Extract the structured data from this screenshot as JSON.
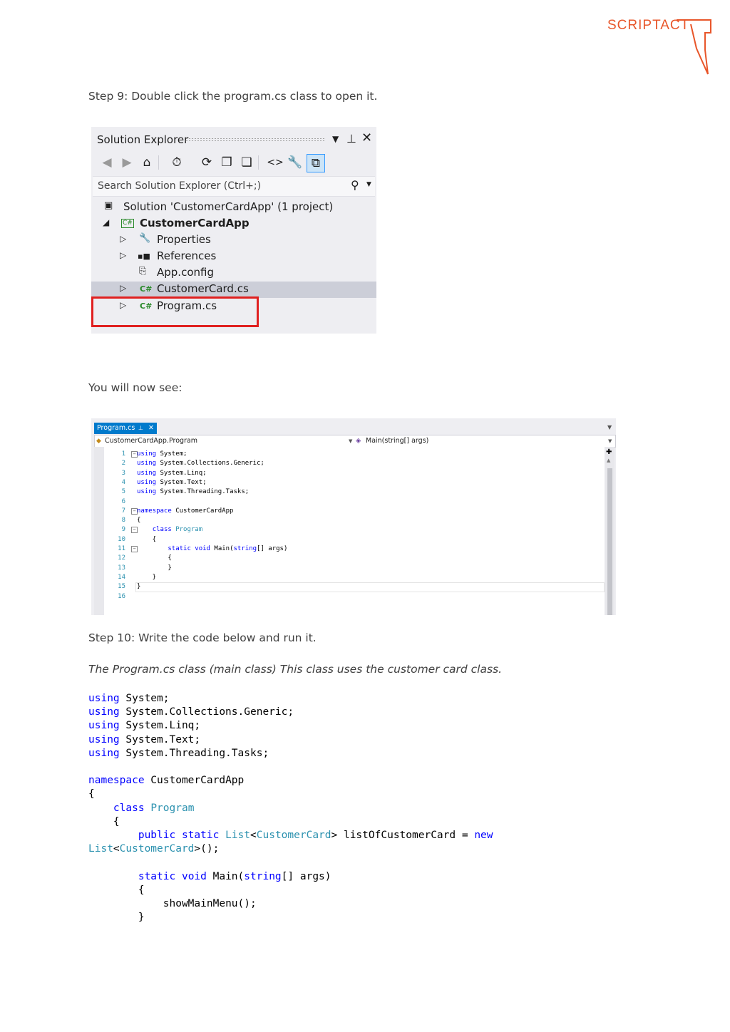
{
  "logo": {
    "text": "SCRIPTACT",
    "color": "#e8562a"
  },
  "step9": "Step 9: Double click the program.cs class to open it.",
  "solution_explorer": {
    "title": "Solution Explorer",
    "search_placeholder": "Search Solution Explorer (Ctrl+;)",
    "toolbar_icons": [
      "back-icon",
      "forward-icon",
      "home-icon",
      "history-icon",
      "sync-icon",
      "collapse-all-icon",
      "show-all-files-icon",
      "view-code-icon",
      "properties-icon",
      "preview-icon"
    ],
    "items": [
      {
        "label": "Solution 'CustomerCardApp' (1 project)",
        "icon": "solution-icon"
      },
      {
        "label": "CustomerCardApp",
        "icon": "csharp-project-icon"
      },
      {
        "label": "Properties",
        "icon": "wrench-icon"
      },
      {
        "label": "References",
        "icon": "references-icon"
      },
      {
        "label": "App.config",
        "icon": "config-icon"
      },
      {
        "label": "CustomerCard.cs",
        "icon": "csharp-file-icon",
        "selected": true
      },
      {
        "label": "Program.cs",
        "icon": "csharp-file-icon"
      }
    ],
    "highlight_color": "#e02020"
  },
  "now_see": "You will now see:",
  "editor": {
    "tab": "Program.cs",
    "nav_left": "CustomerCardApp.Program",
    "nav_right": "Main(string[] args)",
    "lines": [
      {
        "n": "1",
        "t": "using System;"
      },
      {
        "n": "2",
        "t": "using System.Collections.Generic;"
      },
      {
        "n": "3",
        "t": "using System.Linq;"
      },
      {
        "n": "4",
        "t": "using System.Text;"
      },
      {
        "n": "5",
        "t": "using System.Threading.Tasks;"
      },
      {
        "n": "6",
        "t": ""
      },
      {
        "n": "7",
        "t": "namespace CustomerCardApp"
      },
      {
        "n": "8",
        "t": "{"
      },
      {
        "n": "9",
        "t": "    class Program"
      },
      {
        "n": "10",
        "t": "    {"
      },
      {
        "n": "11",
        "t": "        static void Main(string[] args)"
      },
      {
        "n": "12",
        "t": "        {"
      },
      {
        "n": "13",
        "t": "        }"
      },
      {
        "n": "14",
        "t": "    }"
      },
      {
        "n": "15",
        "t": "}"
      },
      {
        "n": "16",
        "t": ""
      }
    ]
  },
  "step10": "Step 10:  Write the code  below and run it.",
  "caption": "The Program.cs class (main class) This class uses the customer card class.",
  "code": {
    "l1_kw": "using",
    "l1_rest": " System;",
    "l2_kw": "using",
    "l2_rest": " System.Collections.Generic;",
    "l3_kw": "using",
    "l3_rest": " System.Linq;",
    "l4_kw": "using",
    "l4_rest": " System.Text;",
    "l5_kw": "using",
    "l5_rest": " System.Threading.Tasks;",
    "l7_kw": "namespace",
    "l7_rest": " CustomerCardApp",
    "l8": "{",
    "l9_kw": "class",
    "l9_ty": "Program",
    "l10": "{",
    "l11_kw1": "public",
    "l11_kw2": "static",
    "l11_ty1": "List",
    "l11_ty2": "CustomerCard",
    "l11_rest": "> listOfCustomerCard = ",
    "l11_kw3": "new",
    "l12_ty1": "List",
    "l12_ty2": "CustomerCard",
    "l12_rest": ">();",
    "l14_kw1": "static",
    "l14_kw2": "void",
    "l14_rest1": " Main(",
    "l14_kw3": "string",
    "l14_rest2": "[] args)",
    "l15": "{",
    "l16": "showMainMenu();",
    "l17": "}"
  }
}
